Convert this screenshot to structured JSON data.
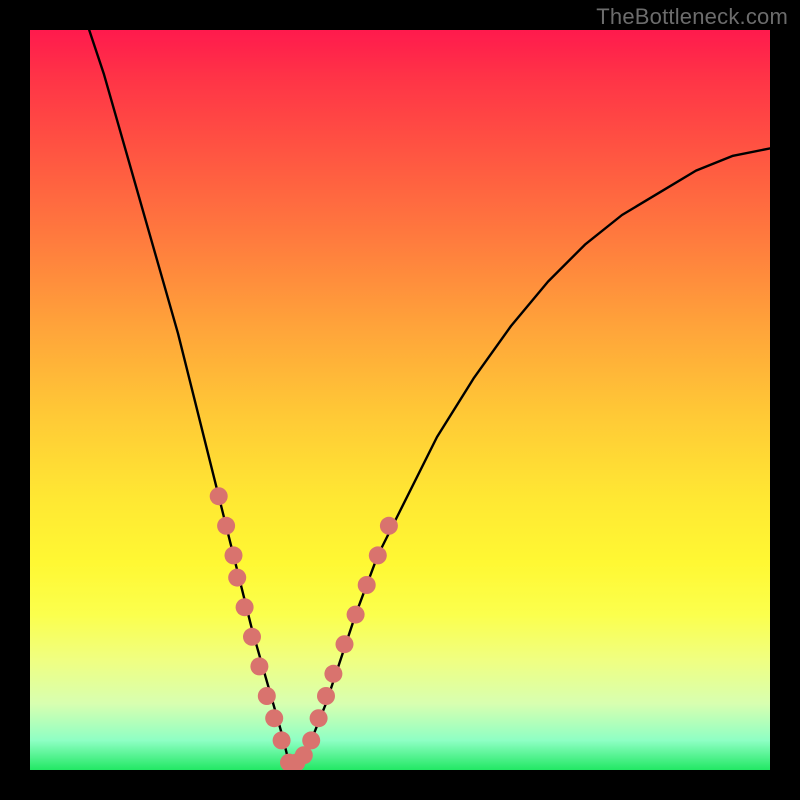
{
  "watermark": "TheBottleneck.com",
  "colors": {
    "black": "#000000",
    "curve": "#000000",
    "marker_fill": "#d9736e",
    "marker_stroke": "#a94a4a"
  },
  "chart_data": {
    "type": "line",
    "title": "",
    "xlabel": "",
    "ylabel": "",
    "xlim": [
      0,
      100
    ],
    "ylim": [
      0,
      100
    ],
    "grid": false,
    "legend": false,
    "note": "V-shaped bottleneck curve on rainbow gradient; minimum near x≈35, y≈0. Values estimated from pixel positions (no axes/ticks shown).",
    "series": [
      {
        "name": "curve",
        "x": [
          8,
          10,
          12,
          14,
          16,
          18,
          20,
          22,
          24,
          26,
          28,
          30,
          32,
          34,
          35,
          36,
          38,
          40,
          42,
          44,
          47,
          50,
          55,
          60,
          65,
          70,
          75,
          80,
          85,
          90,
          95,
          100
        ],
        "y": [
          100,
          94,
          87,
          80,
          73,
          66,
          59,
          51,
          43,
          35,
          27,
          19,
          12,
          5,
          1,
          1,
          4,
          9,
          15,
          21,
          29,
          35,
          45,
          53,
          60,
          66,
          71,
          75,
          78,
          81,
          83,
          84
        ]
      }
    ],
    "markers": {
      "name": "highlighted-points",
      "x": [
        25.5,
        26.5,
        27.5,
        28.0,
        29.0,
        30.0,
        31.0,
        32.0,
        33.0,
        34.0,
        35.0,
        36.0,
        37.0,
        38.0,
        39.0,
        40.0,
        41.0,
        42.5,
        44.0,
        45.5,
        47.0,
        48.5
      ],
      "y": [
        37,
        33,
        29,
        26,
        22,
        18,
        14,
        10,
        7,
        4,
        1,
        1,
        2,
        4,
        7,
        10,
        13,
        17,
        21,
        25,
        29,
        33
      ]
    }
  }
}
